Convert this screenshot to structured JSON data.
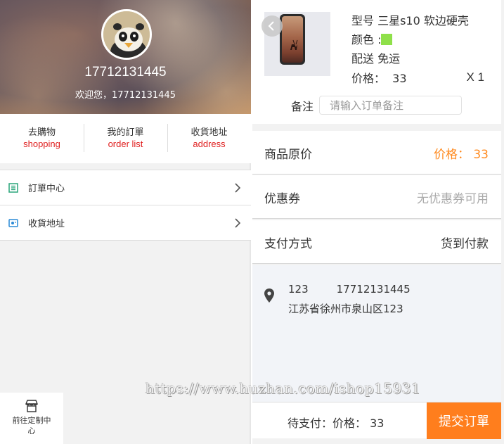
{
  "profile": {
    "user_id": "17712131445",
    "welcome": "欢迎您，17712131445"
  },
  "quick_links": [
    {
      "zh": "去購物",
      "en": "shopping"
    },
    {
      "zh": "我的訂單",
      "en": "order list"
    },
    {
      "zh": "收貨地址",
      "en": "address"
    }
  ],
  "menu": [
    {
      "label": "訂單中心",
      "icon": "order-list-icon"
    },
    {
      "label": "收貨地址",
      "icon": "address-card-icon"
    }
  ],
  "footer_nav": {
    "label": "前往定制中心",
    "icon": "shop-icon"
  },
  "product": {
    "model": "型号 三星s10 软边硬壳",
    "color_label": "颜色 :",
    "color_swatch": "#8fe04a",
    "shipping": "配送 免运",
    "price": "价格：  33",
    "qty": "X 1"
  },
  "note": {
    "label": "备注",
    "placeholder": "请输入订单备注"
  },
  "summary": [
    {
      "key": "商品原价",
      "value": "价格： 33",
      "color": "#ff8a1f"
    },
    {
      "key": "优惠券",
      "value": "无优惠券可用",
      "color": "#aaaaaa"
    },
    {
      "key": "支付方式",
      "value": "货到付款",
      "color": "#333333"
    }
  ],
  "address": {
    "name": "123",
    "phone": "17712131445",
    "detail": "江苏省徐州市泉山区123"
  },
  "checkout": {
    "total": "待支付：价格： 33",
    "submit": "提交订單"
  },
  "watermark": "https://www.huzhan.com/ishop15931"
}
